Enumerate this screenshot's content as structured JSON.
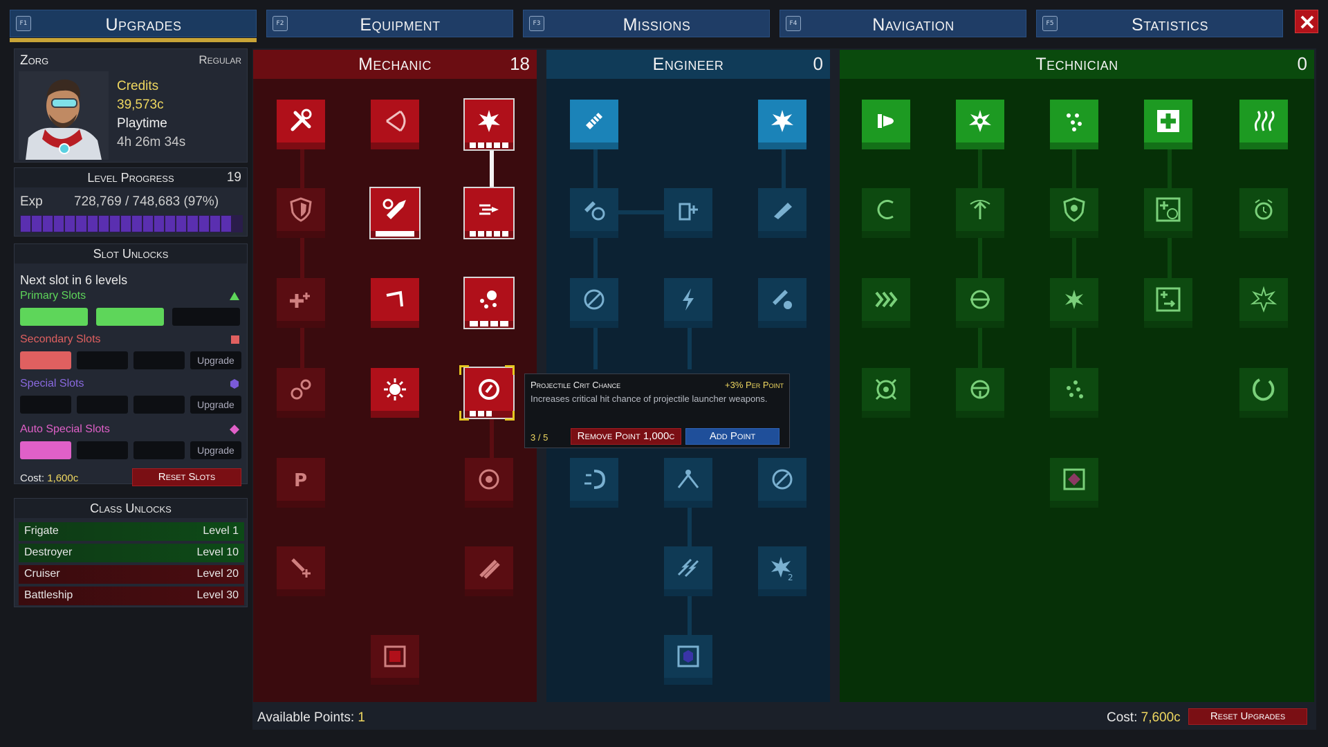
{
  "tabs": [
    {
      "key": "F1",
      "label": "Upgrades",
      "active": true
    },
    {
      "key": "F2",
      "label": "Equipment"
    },
    {
      "key": "F3",
      "label": "Missions"
    },
    {
      "key": "F4",
      "label": "Navigation"
    },
    {
      "key": "F5",
      "label": "Statistics"
    }
  ],
  "profile": {
    "name": "Zorg",
    "rank": "Regular",
    "credits_label": "Credits",
    "credits": "39,573c",
    "playtime_label": "Playtime",
    "playtime": "4h 26m 34s"
  },
  "level": {
    "title": "Level Progress",
    "level": "19",
    "exp_label": "Exp",
    "exp": "728,769 / 748,683 (97%)",
    "progress": 0.97
  },
  "slots": {
    "title": "Slot Unlocks",
    "next": "Next slot in 6 levels",
    "primary": {
      "label": "Primary Slots",
      "color": "#5ed65a"
    },
    "secondary": {
      "label": "Secondary Slots",
      "color": "#e06060"
    },
    "special": {
      "label": "Special Slots",
      "color": "#7a5ad8"
    },
    "auto": {
      "label": "Auto Special Slots",
      "color": "#e060c8"
    },
    "upgrade_label": "Upgrade",
    "cost_label": "Cost:",
    "cost": "1,600c",
    "reset_label": "Reset Slots"
  },
  "classes": {
    "title": "Class Unlocks",
    "rows": [
      {
        "name": "Frigate",
        "level": "Level 1"
      },
      {
        "name": "Destroyer",
        "level": "Level 10"
      },
      {
        "name": "Cruiser",
        "level": "Level 20"
      },
      {
        "name": "Battleship",
        "level": "Level 30"
      }
    ]
  },
  "trees": {
    "mechanic": {
      "title": "Mechanic",
      "points": "18"
    },
    "engineer": {
      "title": "Engineer",
      "points": "0"
    },
    "technician": {
      "title": "Technician",
      "points": "0"
    }
  },
  "tooltip": {
    "title": "Projectile Crit Chance",
    "rate": "+3% Per Point",
    "desc": "Increases critical hit chance of projectile launcher weapons.",
    "count": "3 / 5",
    "remove_label": "Remove Point 1,000c",
    "add_label": "Add Point"
  },
  "footer": {
    "available_label": "Available Points:",
    "available": "1",
    "cost_label": "Cost:",
    "cost": "7,600c",
    "reset_label": "Reset Upgrades"
  }
}
